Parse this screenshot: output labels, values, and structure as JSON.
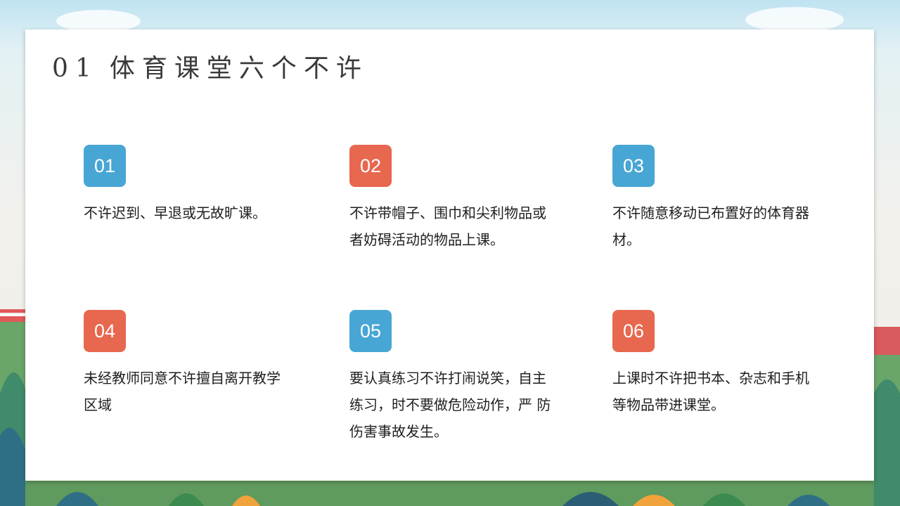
{
  "title": {
    "number": "01",
    "text": "体育课堂六个不许"
  },
  "items": [
    {
      "num": "01",
      "text": "不许迟到、早退或无故旷课。",
      "color": "#47a6d4"
    },
    {
      "num": "02",
      "text": "不许带帽子、围巾和尖利物品或者妨碍活动的物品上课。",
      "color": "#e8674f"
    },
    {
      "num": "03",
      "text": "不许随意移动已布置好的体育器材。",
      "color": "#47a6d4"
    },
    {
      "num": "04",
      "text": "未经教师同意不许擅自离开教学区域",
      "color": "#e8674f"
    },
    {
      "num": "05",
      "text": "要认真练习不许打闹说笑，自主练习，时不要做危险动作，严 防伤害事故发生。",
      "color": "#47a6d4"
    },
    {
      "num": "06",
      "text": "上课时不许把书本、杂志和手机等物品带进课堂。",
      "color": "#e8674f"
    }
  ]
}
